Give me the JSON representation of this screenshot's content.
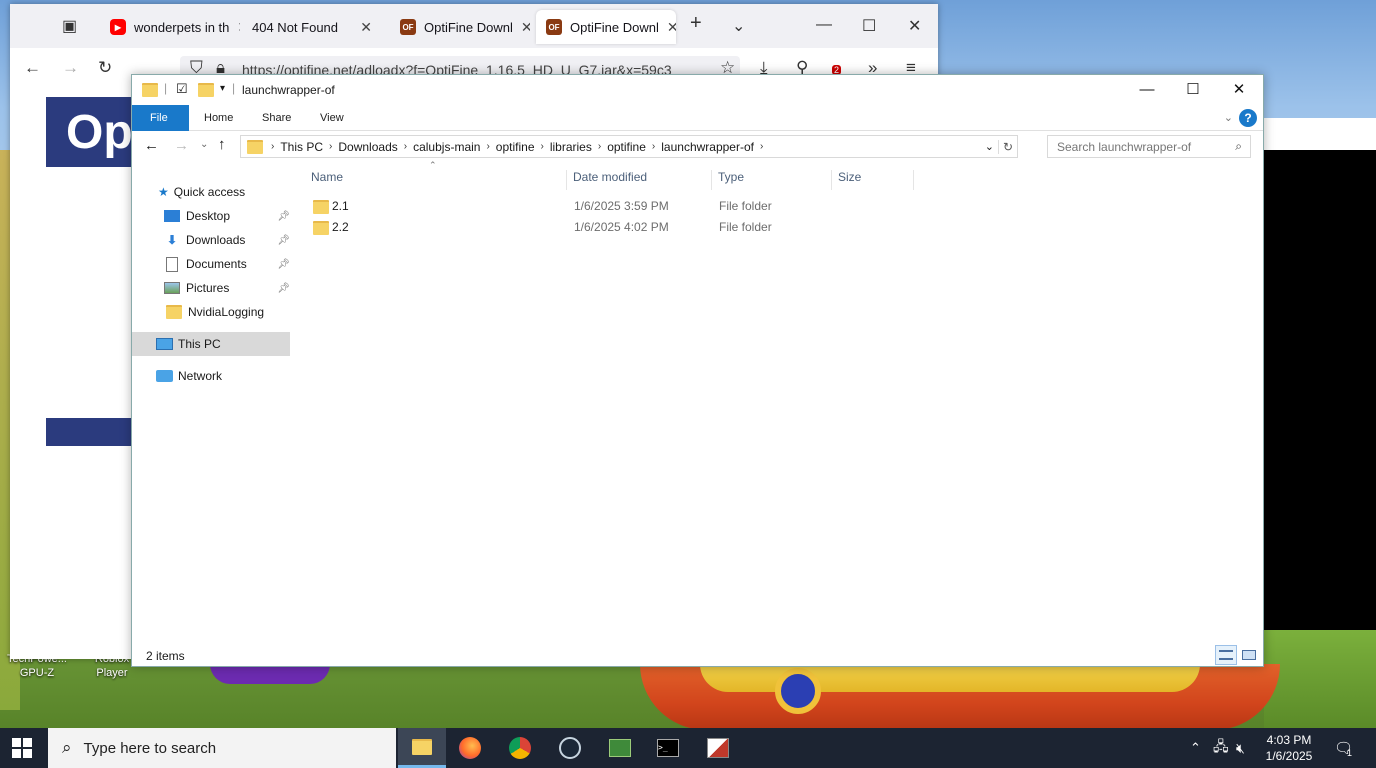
{
  "desktop": {
    "icons": [
      {
        "label_line1": "TechPowe...",
        "label_line2": "GPU-Z"
      },
      {
        "label_line1": "Roblox",
        "label_line2": "Player"
      }
    ]
  },
  "browser": {
    "tabs": [
      {
        "label": "wonderpets in th",
        "icon": "youtube-icon"
      },
      {
        "label": "404 Not Found",
        "icon": "none"
      },
      {
        "label": "OptiFine Downl",
        "icon": "optifine-icon"
      },
      {
        "label": "OptiFine Downl",
        "icon": "optifine-icon",
        "active": true
      }
    ],
    "url": "https://optifine.net/adloadx?f=OptiFine_1.16.5_HD_U_G7.jar&x=59c3",
    "extension_badge": "2",
    "site_banner_text": "Opti"
  },
  "explorer": {
    "title": "launchwrapper-of",
    "ribbon_tabs": [
      "File",
      "Home",
      "Share",
      "View"
    ],
    "breadcrumb": [
      "This PC",
      "Downloads",
      "calubjs-main",
      "optifine",
      "libraries",
      "optifine",
      "launchwrapper-of"
    ],
    "search_placeholder": "Search launchwrapper-of",
    "nav": {
      "quick_access": "Quick access",
      "items": [
        "Desktop",
        "Downloads",
        "Documents",
        "Pictures",
        "NvidiaLogging"
      ],
      "this_pc": "This PC",
      "network": "Network"
    },
    "columns": [
      "Name",
      "Date modified",
      "Type",
      "Size"
    ],
    "files": [
      {
        "name": "2.1",
        "date": "1/6/2025 3:59 PM",
        "type": "File folder",
        "size": ""
      },
      {
        "name": "2.2",
        "date": "1/6/2025 4:02 PM",
        "type": "File folder",
        "size": ""
      }
    ],
    "status": "2 items"
  },
  "taskbar": {
    "search_placeholder": "Type here to search",
    "time": "4:03 PM",
    "date": "1/6/2025",
    "notification_count": "1"
  },
  "colors": {
    "accent": "#1979ca",
    "taskbar": "#1c2432"
  }
}
